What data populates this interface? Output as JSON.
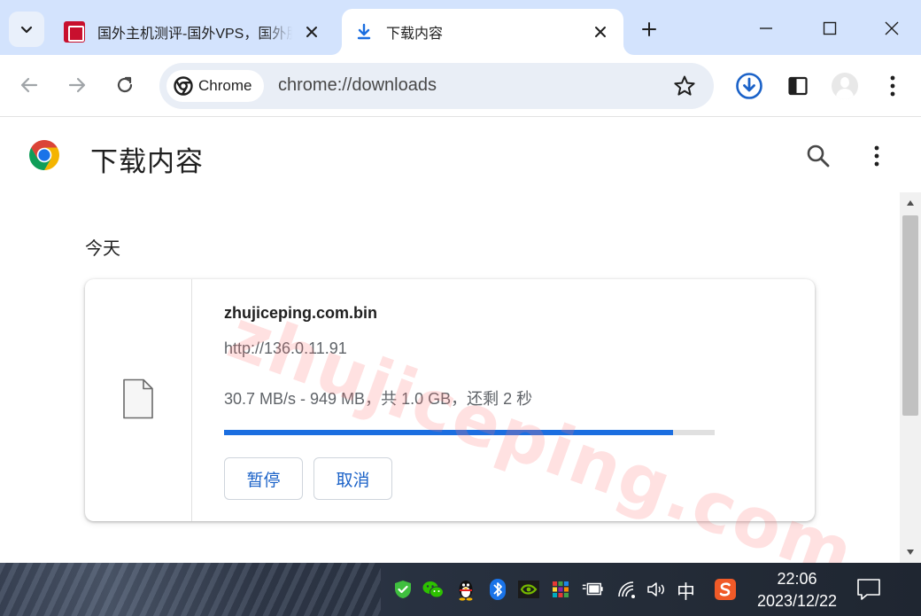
{
  "tabs": [
    {
      "title": "国外主机测评-国外VPS，国外服务器",
      "active": false
    },
    {
      "title": "下载内容",
      "active": true
    }
  ],
  "omnibox": {
    "chip_label": "Chrome",
    "url": "chrome://downloads"
  },
  "page": {
    "title": "下载内容",
    "section_label": "今天"
  },
  "download": {
    "file_name": "zhujiceping.com.bin",
    "source_url": "http://136.0.11.91",
    "status": "30.7 MB/s - 949 MB，共 1.0 GB，还剩 2 秒",
    "progress_fraction": 0.916,
    "pause_label": "暂停",
    "cancel_label": "取消"
  },
  "watermark": "zhujiceping.com",
  "taskbar": {
    "ime_label": "中",
    "time": "22:06",
    "date": "2023/12/22"
  },
  "colors": {
    "tabstrip_bg": "#d3e3fd",
    "accent_blue": "#1b6ee0",
    "button_text": "#1b62c8"
  }
}
